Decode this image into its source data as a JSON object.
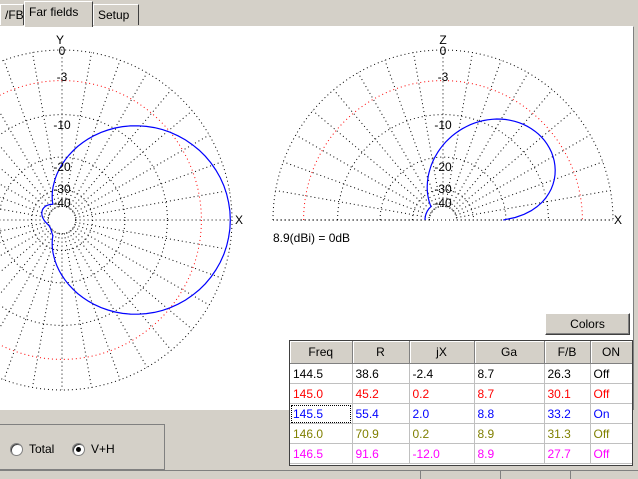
{
  "tabs": [
    {
      "label": "/FB",
      "active": false
    },
    {
      "label": "Far fields",
      "active": true
    },
    {
      "label": "Setup",
      "active": false
    }
  ],
  "plot_labels": {
    "left_axis_top": "Y",
    "left_axis_right": "X",
    "right_axis_top": "Z",
    "right_axis_right": "X",
    "rings": [
      "0",
      "-3",
      "-10",
      "-20",
      "-30",
      "-40"
    ],
    "gain_ref": "8.9(dBi) = 0dB"
  },
  "colors_button": "Colors",
  "radios": [
    {
      "label": "Total",
      "checked": false
    },
    {
      "label": "V+H",
      "checked": true
    }
  ],
  "table": {
    "headers": [
      "Freq",
      "R",
      "jX",
      "Ga",
      "F/B",
      "ON"
    ],
    "rows": [
      {
        "color": "#000000",
        "cells": [
          "144.5",
          "38.6",
          "-2.4",
          "8.7",
          "26.3",
          "Off"
        ]
      },
      {
        "color": "#ff0000",
        "cells": [
          "145.0",
          "45.2",
          "0.2",
          "8.7",
          "30.1",
          "Off"
        ]
      },
      {
        "color": "#0000ff",
        "cells": [
          "145.5",
          "55.4",
          "2.0",
          "8.8",
          "33.2",
          "On"
        ]
      },
      {
        "color": "#808000",
        "cells": [
          "146.0",
          "70.9",
          "0.2",
          "8.9",
          "31.3",
          "Off"
        ]
      },
      {
        "color": "#ff00ff",
        "cells": [
          "146.5",
          "91.6",
          "-12.0",
          "8.9",
          "27.7",
          "Off"
        ]
      }
    ]
  },
  "colors": {
    "trace": "#0000ff",
    "ref_ring": "#ff0000",
    "grid": "#000000"
  }
}
